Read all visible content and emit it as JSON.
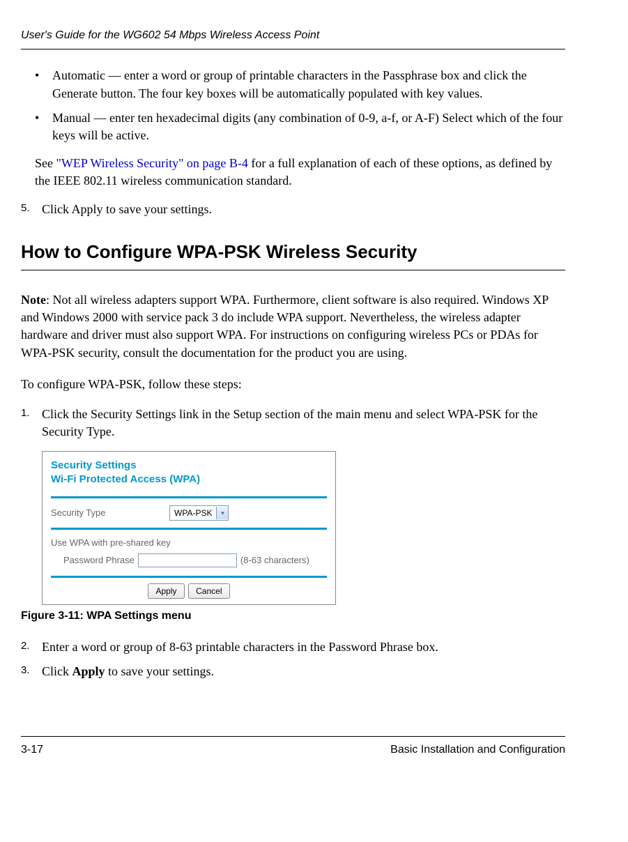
{
  "header": {
    "title": "User's Guide for the WG602 54 Mbps Wireless Access Point"
  },
  "bullets": {
    "item1": "Automatic — enter a word or group of printable characters in the Passphrase box and click the Generate button. The four key boxes will be automatically populated with key values.",
    "item2": "Manual — enter ten hexadecimal digits (any combination of 0-9, a-f, or A-F) Select which of the four keys will be active."
  },
  "see_text": {
    "prefix": "See ",
    "link": "\"WEP Wireless Security\" on page B-4",
    "suffix": " for a full explanation of each of these options, as defined by the IEEE 802.11 wireless communication standard."
  },
  "step5": {
    "num": "5.",
    "text": "Click Apply to save your settings."
  },
  "heading": "How to Configure WPA-PSK Wireless Security",
  "note": {
    "label": "Note",
    "text": ": Not all wireless adapters support WPA. Furthermore, client software is also required. Windows XP and Windows 2000 with service pack 3 do include WPA support. Nevertheless, the wireless adapter hardware and driver must also support WPA. For instructions on configuring wireless PCs or PDAs for WPA-PSK security, consult the documentation for the product you are using."
  },
  "intro": "To configure WPA-PSK, follow these steps:",
  "step1": {
    "num": "1.",
    "text": "Click the Security Settings link in the Setup section of the main menu and select WPA-PSK for the Security Type."
  },
  "figure": {
    "title1": "Security Settings",
    "title2": "Wi-Fi Protected Access (WPA)",
    "security_type_label": "Security Type",
    "security_type_value": "WPA-PSK",
    "psk_label": "Use WPA with pre-shared key",
    "password_label": "Password Phrase",
    "chars_hint": "(8-63 characters)",
    "apply_btn": "Apply",
    "cancel_btn": "Cancel"
  },
  "caption": "Figure 3-11: WPA Settings menu",
  "step2": {
    "num": "2.",
    "text": "Enter a word or group of 8-63 printable characters in the Password Phrase box."
  },
  "step3": {
    "num": "3.",
    "prefix": "Click ",
    "bold": "Apply",
    "suffix": " to save your settings."
  },
  "footer": {
    "page": "3-17",
    "section": "Basic Installation and Configuration"
  }
}
